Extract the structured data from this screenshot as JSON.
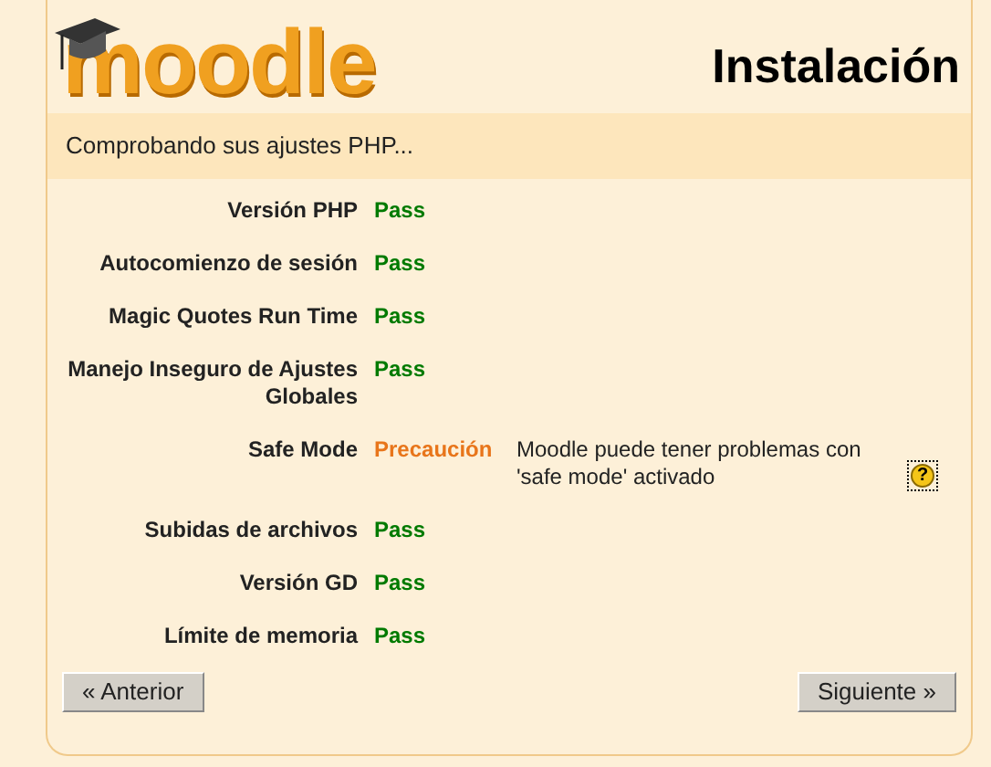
{
  "logo": {
    "text": "moodle"
  },
  "page_title": "Instalación",
  "subheading": "Comprobando sus ajustes PHP...",
  "checks": [
    {
      "label": "Versión PHP",
      "status": "Pass",
      "kind": "pass"
    },
    {
      "label": "Autocomienzo de sesión",
      "status": "Pass",
      "kind": "pass"
    },
    {
      "label": "Magic Quotes Run Time",
      "status": "Pass",
      "kind": "pass"
    },
    {
      "label": "Manejo Inseguro de Ajustes Globales",
      "status": "Pass",
      "kind": "pass"
    },
    {
      "label": "Safe Mode",
      "status": "Precaución",
      "kind": "warning",
      "note": "Moodle puede tener problemas con 'safe mode' activado",
      "help": "?"
    },
    {
      "label": "Subidas de archivos",
      "status": "Pass",
      "kind": "pass"
    },
    {
      "label": "Versión GD",
      "status": "Pass",
      "kind": "pass"
    },
    {
      "label": "Límite de memoria",
      "status": "Pass",
      "kind": "pass"
    }
  ],
  "buttons": {
    "previous": "« Anterior",
    "next": "Siguiente »"
  }
}
